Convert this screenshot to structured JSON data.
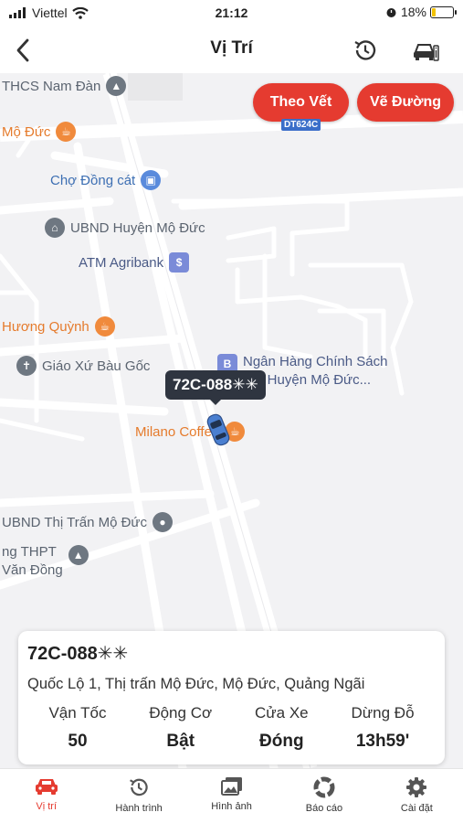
{
  "status_bar": {
    "carrier": "Viettel",
    "time": "21:12",
    "battery": "18%",
    "battery_level": 0.18
  },
  "nav": {
    "title": "Vị Trí",
    "icons": [
      "back-chevron-icon",
      "history-icon",
      "vehicle-info-icon"
    ]
  },
  "map": {
    "buttons": {
      "track": "Theo Vết",
      "draw_route": "Vẽ Đường"
    },
    "road_shield": "DT624C",
    "pois": {
      "thcs": "THCS Nam Đàn",
      "mo_duc": "Mộ Đức",
      "cho_dong_cat": "Chợ Đồng cát",
      "ubnd_huyen": "UBND Huyện Mộ Đức",
      "atm": "ATM Agribank",
      "huong_quynh": "Hương Quỳnh",
      "giao_xu": "Giáo Xứ Bàu Gốc",
      "ngan_hang_1": "Ngân Hàng Chính Sách",
      "ngan_hang_2": "Hội Huyện Mộ Đức...",
      "milano": "Milano Coffee",
      "ubnd_thi_tran": "UBND Thị Trấn Mộ Đức",
      "thpt_1": "ng THPT",
      "thpt_2": "Văn Đồng"
    },
    "vehicle_tooltip": "72C-088✳✳"
  },
  "vehicle": {
    "plate": "72C-088✳✳",
    "address": "Quốc Lộ 1, Thị trấn Mộ Đức, Mộ Đức, Quảng Ngãi",
    "stats": [
      {
        "label": "Vận Tốc",
        "value": "50"
      },
      {
        "label": "Động Cơ",
        "value": "Bật"
      },
      {
        "label": "Cửa Xe",
        "value": "Đóng"
      },
      {
        "label": "Dừng Đỗ",
        "value": "13h59'"
      }
    ]
  },
  "tabs": [
    {
      "label": "Vị trí",
      "icon": "car-icon",
      "active": true
    },
    {
      "label": "Hành trình",
      "icon": "history-icon",
      "active": false
    },
    {
      "label": "Hình ảnh",
      "icon": "gallery-icon",
      "active": false
    },
    {
      "label": "Báo cáo",
      "icon": "report-icon",
      "active": false
    },
    {
      "label": "Cài đặt",
      "icon": "settings-gear-icon",
      "active": false
    }
  ],
  "colors": {
    "accent": "#e53b30",
    "map_background": "#f2f2f4",
    "tooltip": "#2f3540",
    "car": "#4a7fd0"
  }
}
